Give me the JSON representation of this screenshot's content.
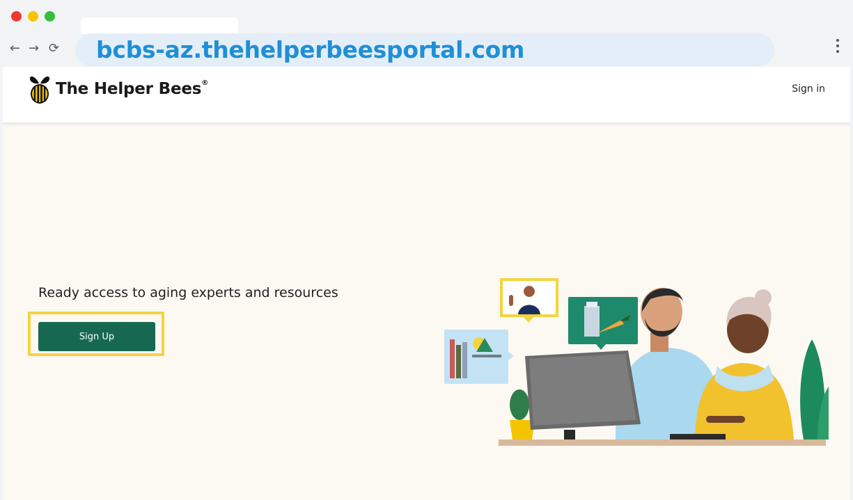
{
  "browser": {
    "url": "bcbs-az.thehelperbeesportal.com",
    "icons": {
      "back": "arrow-left-icon",
      "forward": "arrow-right-icon",
      "reload": "reload-icon",
      "menu": "kebab-menu-icon"
    }
  },
  "header": {
    "brand": "The Helper Bees",
    "brand_mark": "®",
    "signin_label": "Sign in"
  },
  "hero": {
    "headline": "Ready access to aging experts and resources",
    "signup_label": "Sign Up"
  },
  "colors": {
    "url_text": "#1f8fd6",
    "primary_button": "#176850",
    "highlight": "#f5d33e",
    "page_background": "#fcf9f3"
  }
}
